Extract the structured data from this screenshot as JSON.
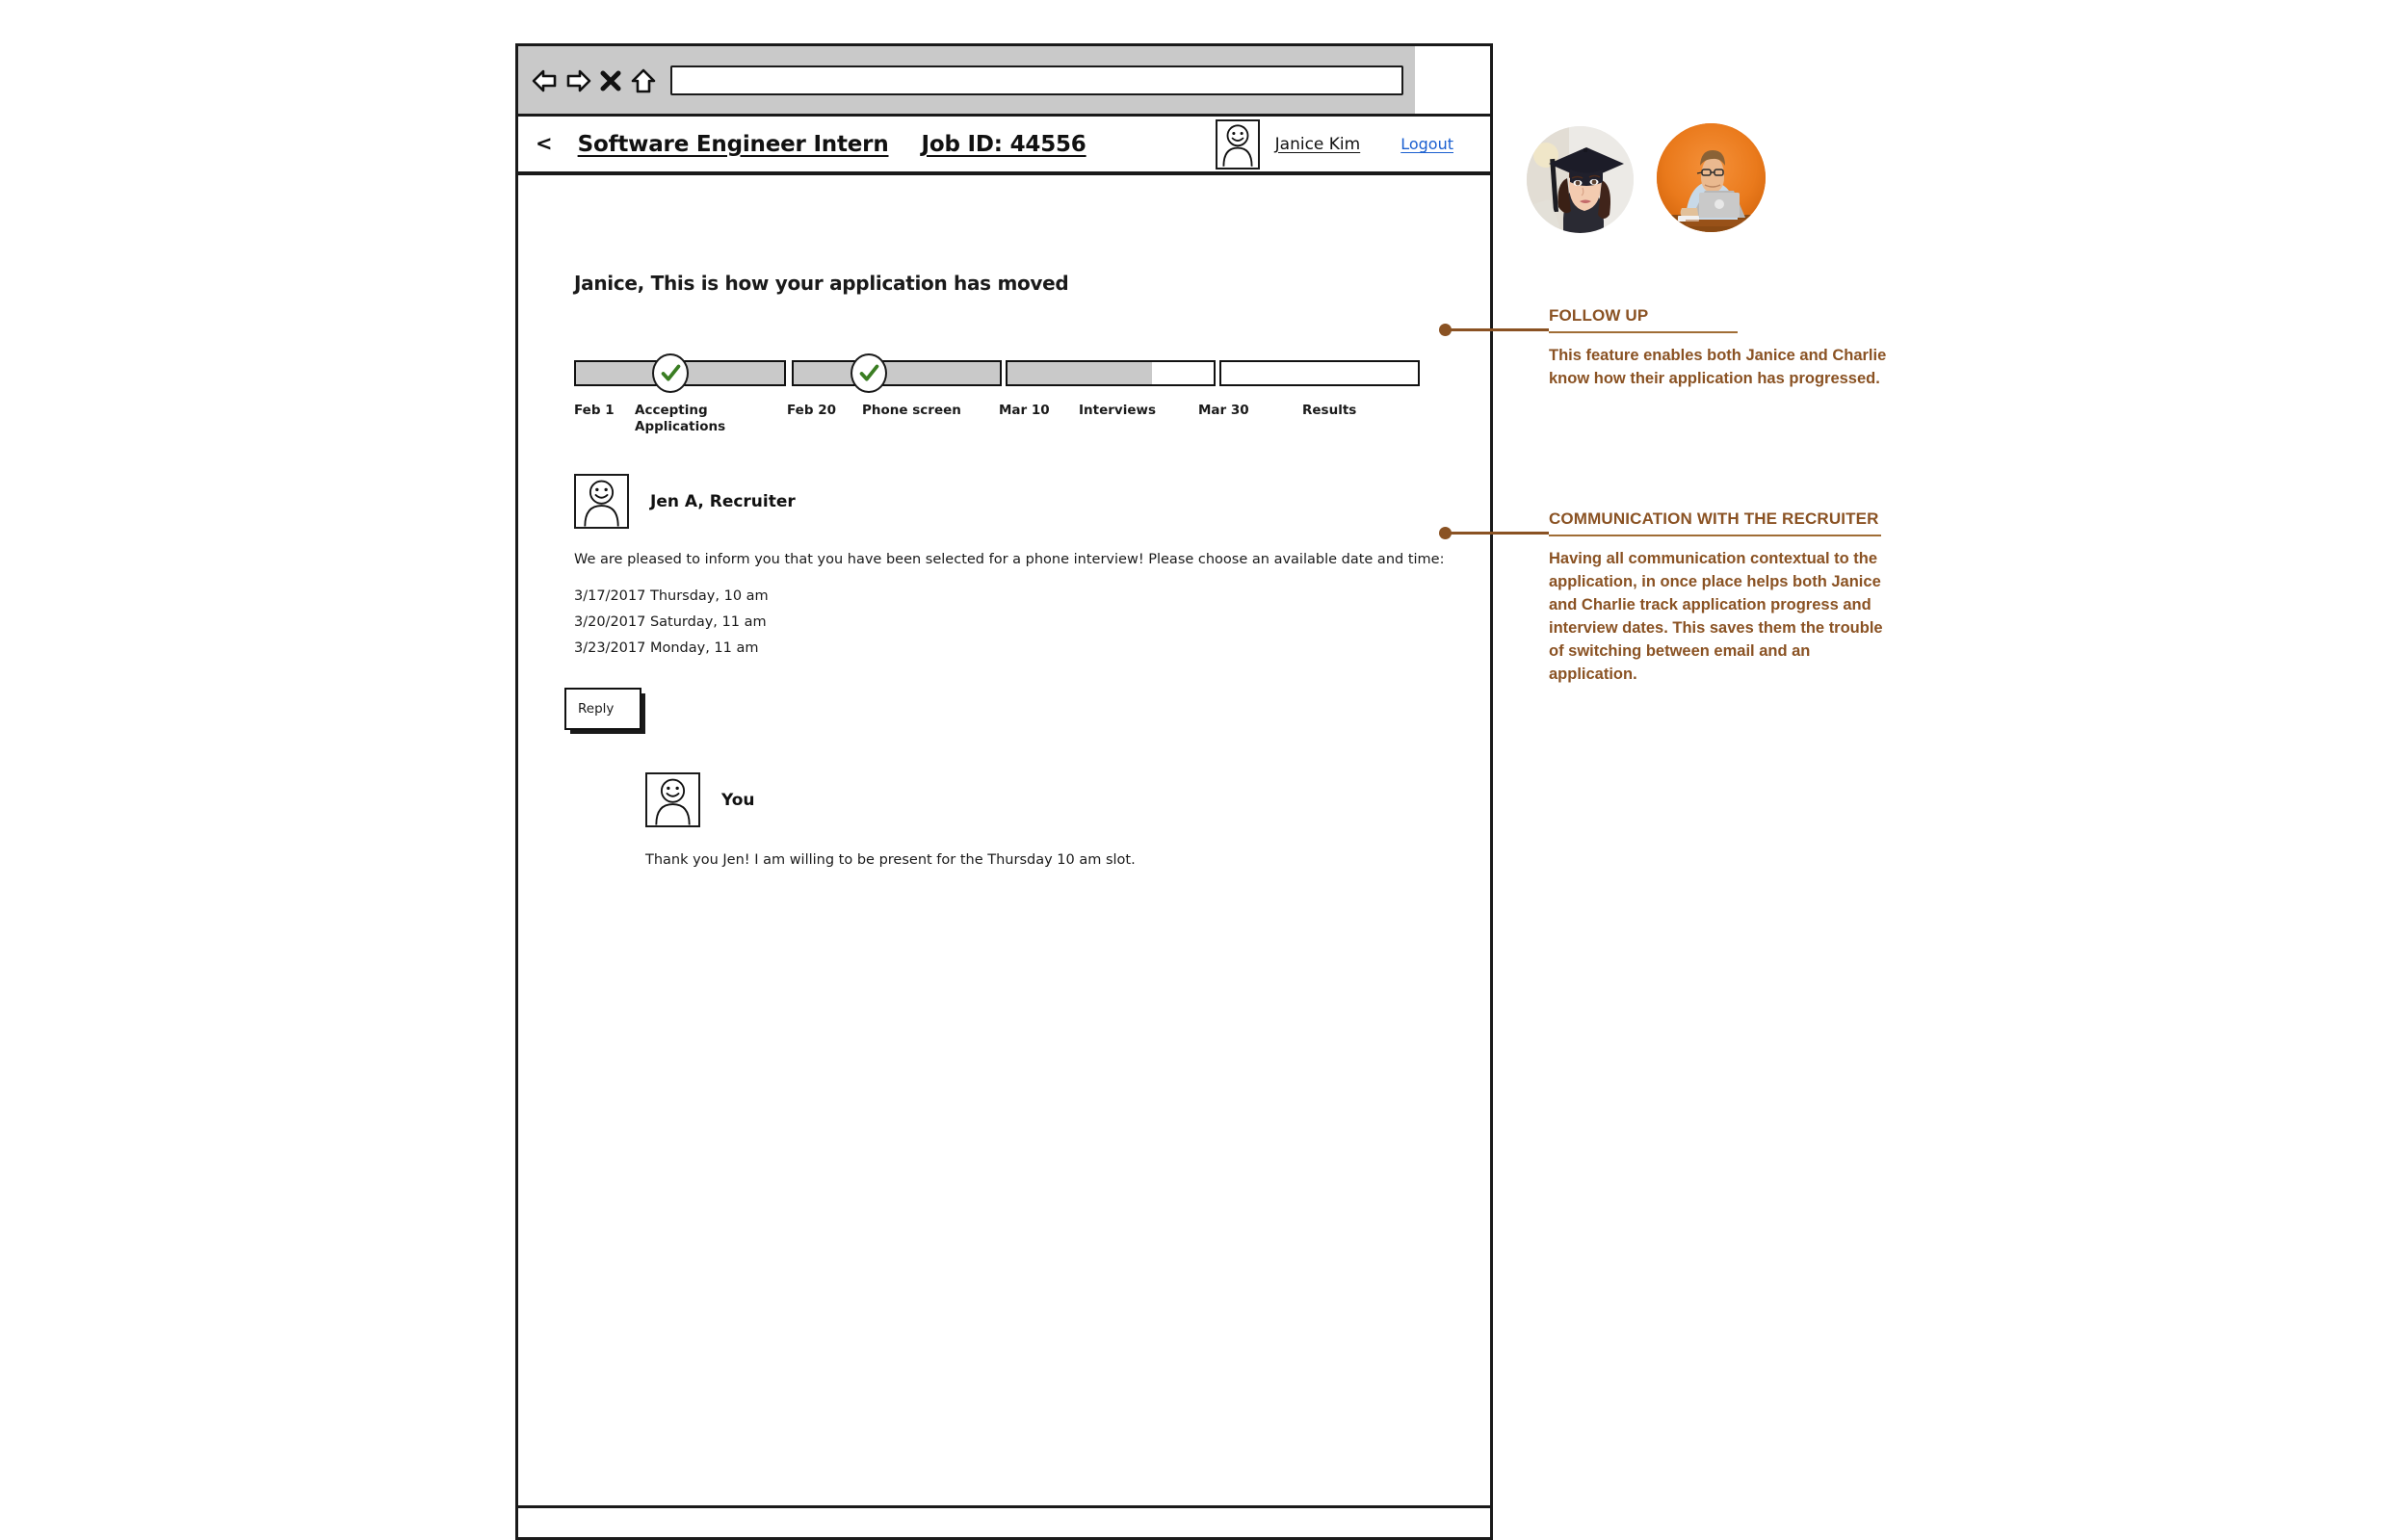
{
  "browser": {
    "nav_icons": [
      "back-arrow-icon",
      "forward-arrow-icon",
      "close-x-icon",
      "home-icon"
    ],
    "url_value": "",
    "url_placeholder": ""
  },
  "app_header": {
    "back_chevron": "<",
    "job_title": "Software Engineer Intern",
    "job_id": "Job ID: 44556",
    "user_name": "Janice Kim",
    "logout_label": "Logout"
  },
  "main": {
    "greeting": "Janice, This is how your application has moved"
  },
  "progress": {
    "segments": [
      {
        "label": "Accepting\nApplications",
        "start_date": "Feb 1",
        "fill_percent": 100,
        "complete": true
      },
      {
        "label": "Phone screen",
        "start_date": "Feb 20",
        "fill_percent": 100,
        "complete": true
      },
      {
        "label": "Interviews",
        "start_date": "Mar 10",
        "fill_percent": 70,
        "complete": false
      },
      {
        "label": "Results",
        "start_date": "Mar 30",
        "fill_percent": 0,
        "complete": false
      }
    ],
    "tick_labels": [
      "Feb 1",
      "Accepting\nApplications",
      "Feb 20",
      "Phone screen",
      "Mar 10",
      "Interviews",
      "Mar 30",
      "Results"
    ]
  },
  "messages": {
    "recruiter": {
      "avatar": "user-avatar-icon",
      "name": "Jen A, Recruiter",
      "body": "We are pleased to inform you that you have been selected for a phone interview! Please choose an available date and time:",
      "slots": [
        "3/17/2017 Thursday, 10 am",
        "3/20/2017 Saturday, 11 am",
        "3/23/2017 Monday, 11 am"
      ]
    },
    "reply_button_label": "Reply",
    "you": {
      "avatar": "user-avatar-icon",
      "name": "You",
      "body": "Thank you Jen! I am willing to be present for the Thursday 10 am slot."
    }
  },
  "personas": [
    {
      "name": "janice-graduate-photo",
      "background": "#e9e8e4"
    },
    {
      "name": "charlie-laptop-photo",
      "background": "#e8761d"
    }
  ],
  "annotations": [
    {
      "title": "FOLLOW UP",
      "text": "This feature enables both Janice and Charlie know how their application has progressed."
    },
    {
      "title": "COMMUNICATION WITH THE RECRUITER",
      "text": "Having all communication contextual to the application, in once place helps both Janice and Charlie track application progress and interview dates. This saves them the trouble of switching between email and an application."
    }
  ],
  "colors": {
    "annotation_brown": "#8a5223",
    "link_blue": "#1a5fd0",
    "progress_fill": "#c9c9c9",
    "check_green": "#3a7d22",
    "chrome_grey": "#c9c9c9"
  }
}
